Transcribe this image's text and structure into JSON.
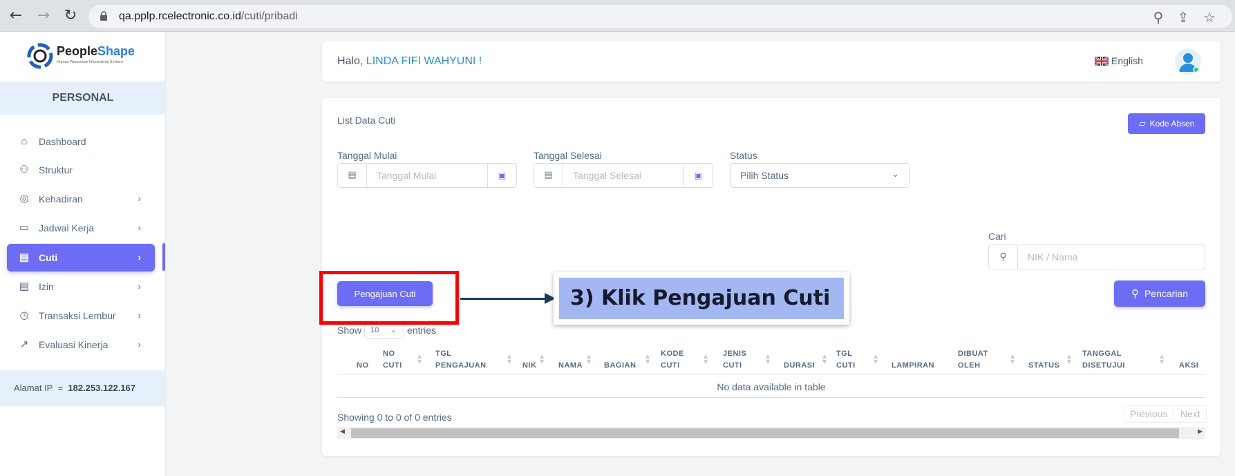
{
  "browser": {
    "url_host": "qa.pplp.rcelectronic.co.id",
    "url_path": "/cuti/pribadi"
  },
  "sidebar": {
    "logo": {
      "people": "People",
      "shape": "Shape",
      "tagline": "Human Resources Information System"
    },
    "section": "PERSONAL",
    "items": [
      {
        "label": "Dashboard",
        "icon": "home-icon",
        "has_chevron": false
      },
      {
        "label": "Struktur",
        "icon": "sitemap-icon",
        "has_chevron": false
      },
      {
        "label": "Kehadiran",
        "icon": "fingerprint-icon",
        "has_chevron": true
      },
      {
        "label": "Jadwal Kerja",
        "icon": "briefcase-icon",
        "has_chevron": true
      },
      {
        "label": "Cuti",
        "icon": "calendar-icon",
        "has_chevron": true,
        "active": true
      },
      {
        "label": "Izin",
        "icon": "calendar-icon",
        "has_chevron": true
      },
      {
        "label": "Transaksi Lembur",
        "icon": "clock-icon",
        "has_chevron": true
      },
      {
        "label": "Evaluasi Kinerja",
        "icon": "chart-icon",
        "has_chevron": true
      }
    ],
    "ip_label": "Alamat IP",
    "ip_sep": "=",
    "ip_value": "182.253.122.167"
  },
  "header": {
    "greeting": "Halo,",
    "user_name": "LINDA FIFI WAHYUNI !",
    "language": "English"
  },
  "main": {
    "title": "List Data Cuti",
    "kode_absen_label": "Kode Absen",
    "tanggal_mulai_label": "Tanggal Mulai",
    "tanggal_mulai_placeholder": "Tanggal Mulai",
    "tanggal_selesai_label": "Tanggal Selesai",
    "tanggal_selesai_placeholder": "Tanggal Selesai",
    "status_label": "Status",
    "status_value": "Pilih Status",
    "cari_label": "Cari",
    "cari_placeholder": "NIK / Nama",
    "pencarian_label": "Pencarian",
    "pengajuan_label": "Pengajuan Cuti",
    "show_label": "Show",
    "show_value": "10",
    "entries_label": "entries",
    "columns": [
      [
        "NO"
      ],
      [
        "NO",
        "CUTI"
      ],
      [
        "TGL",
        "PENGAJUAN"
      ],
      [
        "NIK"
      ],
      [
        "NAMA"
      ],
      [
        "BAGIAN"
      ],
      [
        "KODE",
        "CUTI"
      ],
      [
        "JENIS",
        "CUTI"
      ],
      [
        "DURASI"
      ],
      [
        "TGL",
        "CUTI"
      ],
      [
        "LAMPIRAN"
      ],
      [
        "DIBUAT",
        "OLEH"
      ],
      [
        "STATUS"
      ],
      [
        "TANGGAL",
        "DISETUJUI"
      ],
      [
        "AKSI"
      ]
    ],
    "no_data": "No data available in table",
    "showing": "Showing 0 to 0 of 0 entries",
    "previous": "Previous",
    "next": "Next"
  },
  "annotation": {
    "callout": "3) Klik Pengajuan Cuti",
    "highlight_color": "#ff0000",
    "callout_bg": "#a3b8f2"
  },
  "colors": {
    "accent": "#6c6cf5",
    "user_name": "#2a8fc7"
  }
}
